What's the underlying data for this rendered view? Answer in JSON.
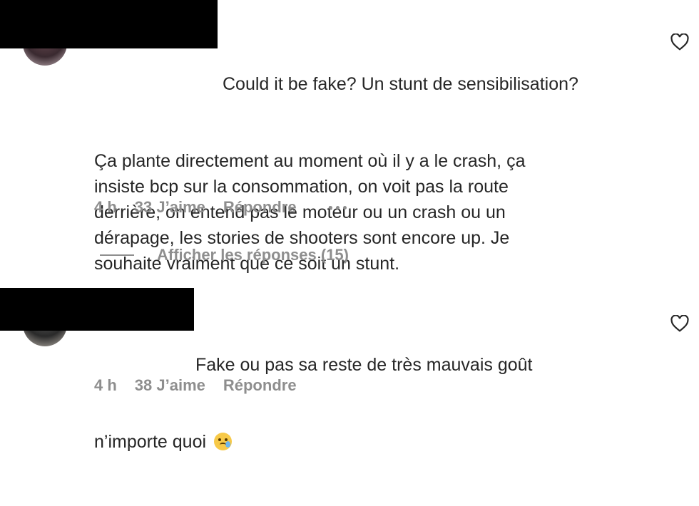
{
  "comments": [
    {
      "text_line1": "Could it be fake? Un stunt de sensibilisation?",
      "text_rest": "Ça plante directement au moment où il y a le crash, ça\ninsiste bcp sur la consommation, on voit pas la route\nderrière, on entend pas le moteur ou un crash ou un\ndérapage, les stories de shooters sont encore up. Je\nsouhaite vraiment que ce soit un stunt.",
      "time": "4 h",
      "likes": "33 J’aime",
      "reply": "Répondre"
    },
    {
      "text_line1": "Fake ou pas sa reste de très mauvais goût",
      "text_rest": "n’importe quoi",
      "time": "4 h",
      "likes": "38 J’aime",
      "reply": "Répondre"
    }
  ],
  "view_replies": "Afficher les réponses (15)",
  "icons": {
    "like": "heart-icon",
    "more": "more-options-icon",
    "emoji": "face-holding-back-tears-emoji"
  },
  "colors": {
    "text": "#262626",
    "secondary": "#8e8e8e",
    "redaction": "#000000"
  }
}
